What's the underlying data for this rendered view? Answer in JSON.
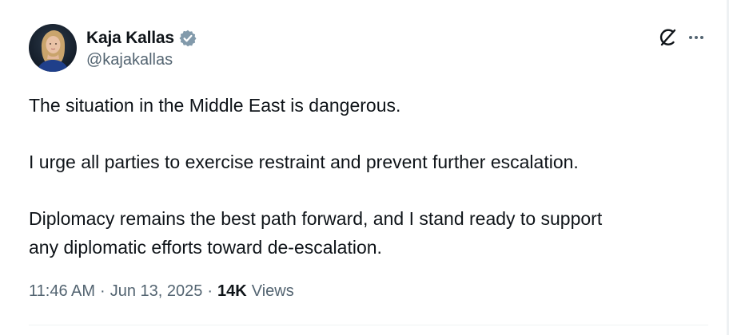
{
  "author": {
    "display_name": "Kaja Kallas",
    "handle": "@kajakallas",
    "verified": true,
    "verified_color": "#829aab",
    "avatar_icon": "profile-photo"
  },
  "actions": {
    "grok_icon": "grok-icon",
    "more_icon": "more-icon"
  },
  "tweet": {
    "paragraphs": [
      "The situation in the Middle East is dangerous.",
      "I urge all parties to exercise restraint and prevent further escalation.",
      "Diplomacy remains the best path forward, and I stand ready to support",
      "any diplomatic efforts toward de-escalation."
    ]
  },
  "meta": {
    "time": "11:46 AM",
    "separator": "·",
    "date": "Jun 13, 2025",
    "views_count": "14K",
    "views_label": "Views"
  }
}
